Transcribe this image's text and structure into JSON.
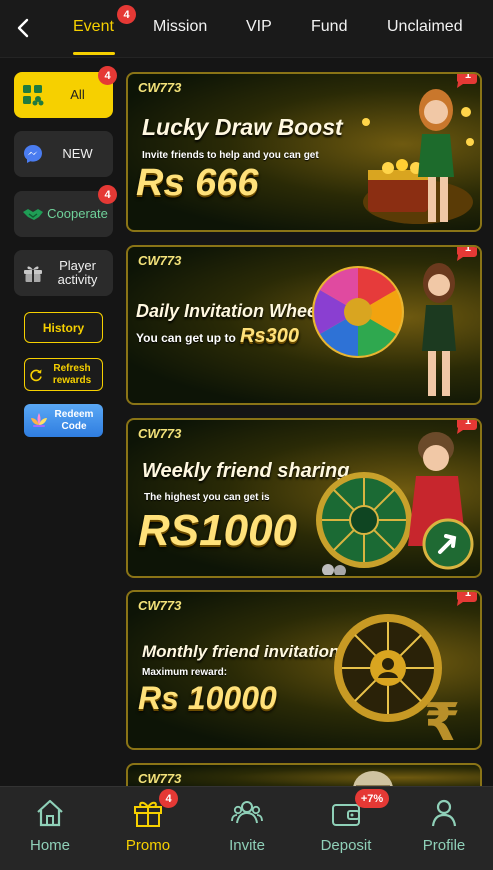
{
  "top_nav": {
    "tabs": [
      {
        "label": "Event",
        "badge": "4"
      },
      {
        "label": "Mission"
      },
      {
        "label": "VIP"
      },
      {
        "label": "Fund"
      },
      {
        "label": "Unclaimed"
      }
    ],
    "active": "Event"
  },
  "sidebar": {
    "items": [
      {
        "label": "All",
        "badge": "4",
        "icon": "grid-icon"
      },
      {
        "label": "NEW",
        "icon": "messenger-icon"
      },
      {
        "label": "Cooperate",
        "badge": "4",
        "icon": "handshake-icon"
      },
      {
        "label": "Player activity",
        "icon": "gift-icon"
      }
    ],
    "history_label": "History",
    "refresh_label": "Refresh rewards",
    "redeem_label": "Redeem Code"
  },
  "banners": [
    {
      "logo": "CW773",
      "title": "Lucky Draw Boost",
      "subtitle": "Invite friends to help and you can get",
      "amount": "Rs 666",
      "badge": "1"
    },
    {
      "logo": "CW773",
      "title": "Daily Invitation Wheel",
      "subtitle": "You can get up to",
      "amount": "Rs300",
      "badge": "1"
    },
    {
      "logo": "CW773",
      "title": "Weekly friend sharing",
      "subtitle": "The highest you can get is",
      "amount": "RS1000",
      "badge": "1"
    },
    {
      "logo": "CW773",
      "title": "Monthly friend invitations",
      "subtitle": "Maximum reward:",
      "amount": "Rs 10000",
      "badge": "1"
    },
    {
      "logo": "CW773"
    }
  ],
  "bottom_nav": {
    "items": [
      {
        "label": "Home",
        "icon": "home-icon"
      },
      {
        "label": "Promo",
        "icon": "gift-icon",
        "badge": "4"
      },
      {
        "label": "Invite",
        "icon": "invite-icon"
      },
      {
        "label": "Deposit",
        "icon": "wallet-icon",
        "badge": "+7%"
      },
      {
        "label": "Profile",
        "icon": "profile-icon"
      }
    ],
    "active": "Promo"
  },
  "colors": {
    "accent": "#f6d000",
    "badge": "#e53935",
    "nav_text": "#8fd0b8"
  }
}
